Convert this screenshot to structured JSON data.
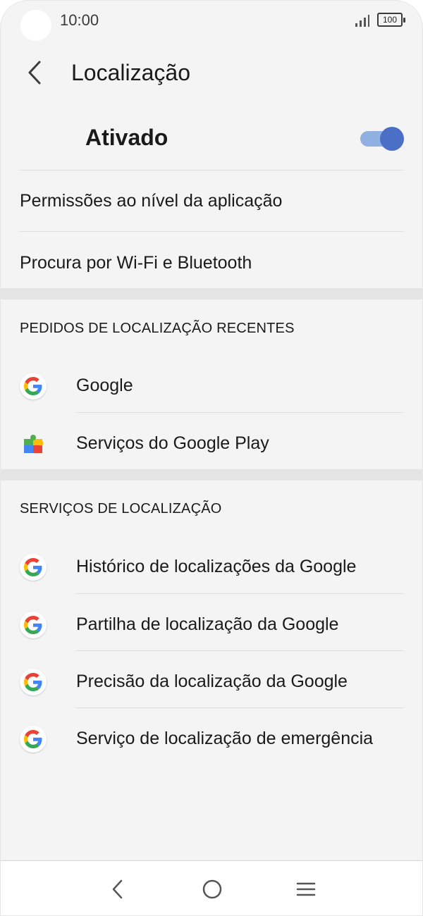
{
  "status_bar": {
    "time": "10:00",
    "battery": "100",
    "icons": [
      "signal-icon",
      "battery-icon"
    ]
  },
  "header": {
    "title": "Localização",
    "back_icon": "chevron-left-icon"
  },
  "master_switch": {
    "label": "Ativado",
    "state": "on",
    "colors": {
      "track": "#8fb0e0",
      "thumb": "#4a6fc4"
    }
  },
  "settings": [
    {
      "label": "Permissões ao nível da aplicação"
    },
    {
      "label": "Procura por Wi-Fi e Bluetooth"
    }
  ],
  "recent_requests": {
    "header": "PEDIDOS DE LOCALIZAÇÃO RECENTES",
    "items": [
      {
        "label": "Google",
        "icon": "google-icon"
      },
      {
        "label": "Serviços do Google Play",
        "icon": "google-play-services-icon"
      }
    ]
  },
  "location_services": {
    "header": "SERVIÇOS DE LOCALIZAÇÃO",
    "items": [
      {
        "label": "Histórico de localizações da Google",
        "icon": "google-icon"
      },
      {
        "label": "Partilha de localização da Google",
        "icon": "google-icon"
      },
      {
        "label": "Precisão da localização da Google",
        "icon": "google-icon"
      },
      {
        "label": "Serviço de localização de emergência",
        "icon": "google-icon"
      }
    ]
  },
  "nav_bar": {
    "icons": [
      "back-icon",
      "home-icon",
      "menu-icon"
    ]
  }
}
